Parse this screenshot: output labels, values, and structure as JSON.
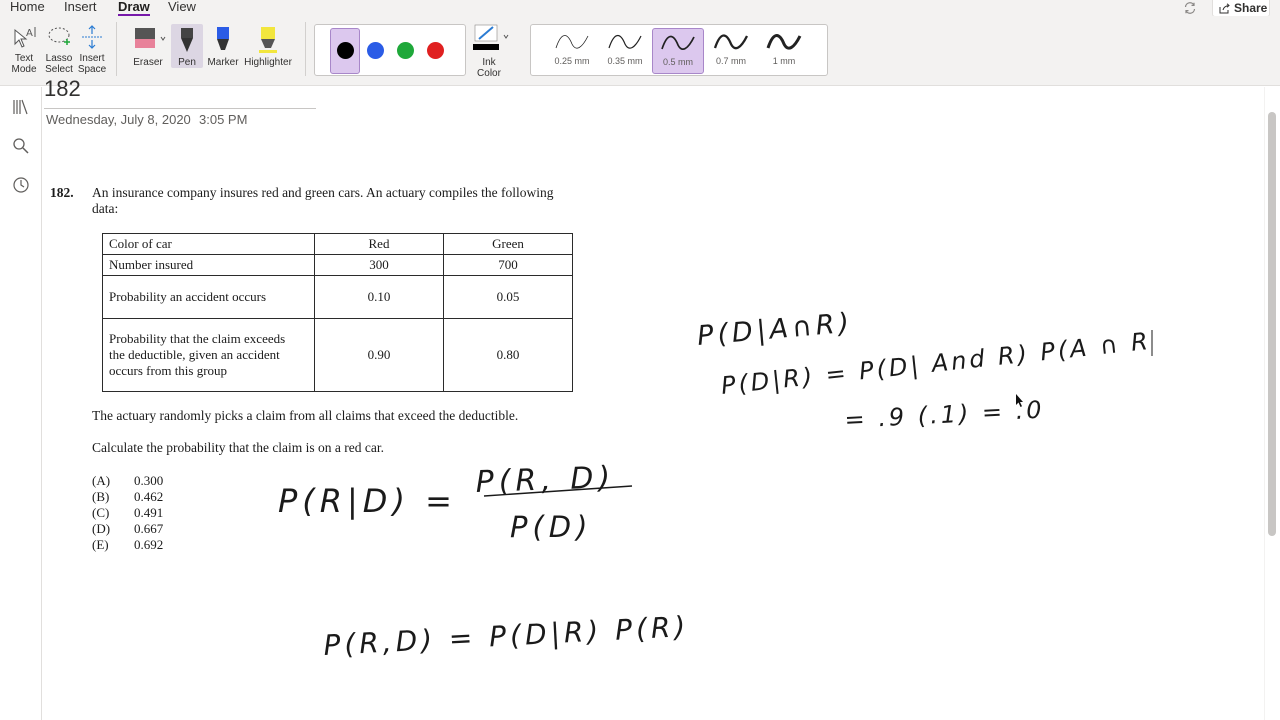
{
  "menu": {
    "tabs": [
      {
        "label": "Home",
        "active": false
      },
      {
        "label": "Insert",
        "active": false
      },
      {
        "label": "Draw",
        "active": true
      },
      {
        "label": "View",
        "active": false
      }
    ],
    "share_label": "Share"
  },
  "ribbon": {
    "text_mode": [
      "Text",
      "Mode"
    ],
    "lasso_select": [
      "Lasso",
      "Select"
    ],
    "insert_space": [
      "Insert",
      "Space"
    ],
    "eraser": "Eraser",
    "pen": "Pen",
    "marker": "Marker",
    "highlighter": "Highlighter",
    "ink_color": [
      "Ink",
      "Color"
    ],
    "colors": [
      "#000000",
      "#2b5ce6",
      "#1fa83a",
      "#e02020"
    ],
    "selected_color": "#000000",
    "thickness": [
      "0.25 mm",
      "0.35 mm",
      "0.5 mm",
      "0.7 mm",
      "1 mm"
    ],
    "selected_thickness": "0.5 mm"
  },
  "page": {
    "title": "182",
    "date": "Wednesday, July 8, 2020",
    "time": "3:05 PM"
  },
  "problem": {
    "number": "182.",
    "intro_line1": "An insurance company insures red and green cars. An actuary compiles the following",
    "intro_line2": "data:",
    "table": {
      "headers": [
        "Color of car",
        "Red",
        "Green"
      ],
      "rows": [
        {
          "label": [
            "Number insured"
          ],
          "red": "300",
          "green": "700"
        },
        {
          "label": [
            "Probability an accident occurs"
          ],
          "red": "0.10",
          "green": "0.05"
        },
        {
          "label": [
            "Probability that the claim exceeds",
            "the deductible, given an accident",
            "occurs from this group"
          ],
          "red": "0.90",
          "green": "0.80"
        }
      ]
    },
    "statement": "The actuary randomly picks a claim from all claims that exceed the deductible.",
    "question": "Calculate the probability that the claim is on a red car.",
    "options": [
      {
        "label": "(A)",
        "value": "0.300"
      },
      {
        "label": "(B)",
        "value": "0.462"
      },
      {
        "label": "(C)",
        "value": "0.491"
      },
      {
        "label": "(D)",
        "value": "0.667"
      },
      {
        "label": "(E)",
        "value": "0.692"
      }
    ]
  },
  "handwriting": {
    "line1": "P(D|A∩R)",
    "line2": "P(D|R) = P(D| And R) P(A ∩ R",
    "line3": "= .9 (.1) = .0",
    "eq_left": "P(R|D) =",
    "eq_num": "P(R, D)",
    "eq_den": "P(D)",
    "eq_bottom": "P(R,D) = P(D|R) P(R)"
  }
}
